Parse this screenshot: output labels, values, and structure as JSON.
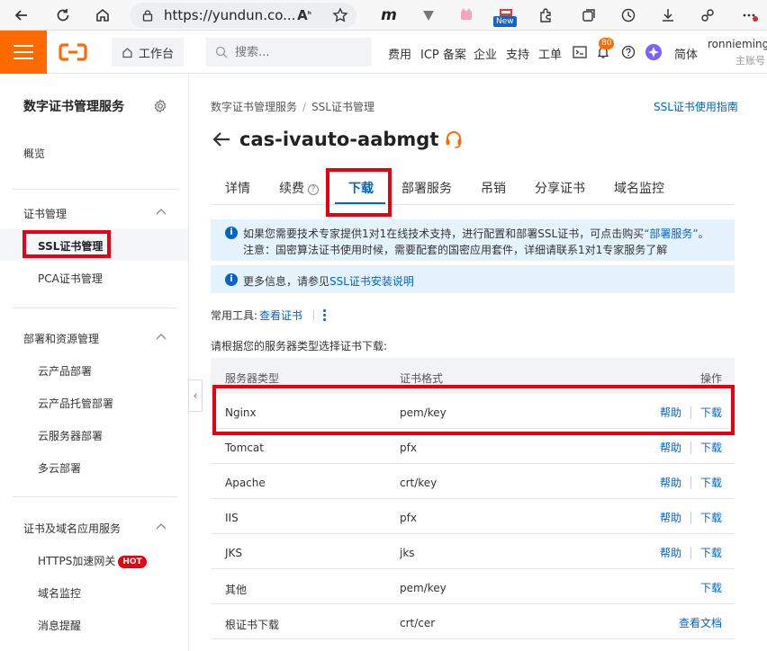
{
  "browser": {
    "url": "https://yundun.co...",
    "new_badge": "New"
  },
  "topbar": {
    "workbench": "工作台",
    "search_placeholder": "搜索...",
    "links": [
      "费用",
      "ICP 备案",
      "企业",
      "支持",
      "工单"
    ],
    "notification_count": "80",
    "language": "简体",
    "user_name": "ronnieming",
    "user_role": "主账号",
    "accent": "#ff6a00"
  },
  "sidebar": {
    "title": "数字证书管理服务",
    "overview": "概览",
    "sections": [
      {
        "label": "证书管理",
        "items": [
          "SSL证书管理",
          "PCA证书管理"
        ]
      },
      {
        "label": "部署和资源管理",
        "items": [
          "云产品部署",
          "云产品托管部署",
          "云服务器部署",
          "多云部署"
        ]
      },
      {
        "label": "证书及域名应用服务",
        "items": [
          "HTTPS加速网关",
          "域名监控",
          "消息提醒"
        ]
      }
    ],
    "hot_badge": "HOT"
  },
  "main": {
    "breadcrumb": [
      "数字证书管理服务",
      "SSL证书管理"
    ],
    "guide_link": "SSL证书使用指南",
    "title": "cas-ivauto-aabmgt",
    "tabs": [
      "详情",
      "续费",
      "下载",
      "部署服务",
      "吊销",
      "分享证书",
      "域名监控"
    ],
    "active_tab": "下载",
    "notice1_line1_pre": "如果您需要技术专家提供1对1在线技术支持，进行配置和部署SSL证书，可点击购买",
    "notice1_link": "“部署服务”",
    "notice1_line1_post": "。",
    "notice1_line2": "注意：国密算法证书使用时候，需要配套的国密应用套件，详细请联系1对1专家服务了解",
    "notice2_pre": "更多信息，请参见",
    "notice2_link": "SSL证书安装说明",
    "tools_label": "常用工具:",
    "tools_link": "查看证书",
    "instruction": "请根据您的服务器类型选择证书下载:",
    "table": {
      "headers": [
        "服务器类型",
        "证书格式",
        "操作"
      ],
      "rows": [
        {
          "server": "Nginx",
          "format": "pem/key",
          "help": "帮助",
          "action": "下载"
        },
        {
          "server": "Tomcat",
          "format": "pfx",
          "help": "帮助",
          "action": "下载"
        },
        {
          "server": "Apache",
          "format": "crt/key",
          "help": "帮助",
          "action": "下载"
        },
        {
          "server": "IIS",
          "format": "pfx",
          "help": "帮助",
          "action": "下载"
        },
        {
          "server": "JKS",
          "format": "jks",
          "help": "帮助",
          "action": "下载"
        },
        {
          "server": "其他",
          "format": "pem/key",
          "help": "",
          "action": "下载"
        },
        {
          "server": "根证书下载",
          "format": "crt/cer",
          "help": "",
          "action": "查看文档"
        }
      ]
    },
    "link_color": "#0064c8",
    "highlight_color": "#e60012"
  }
}
